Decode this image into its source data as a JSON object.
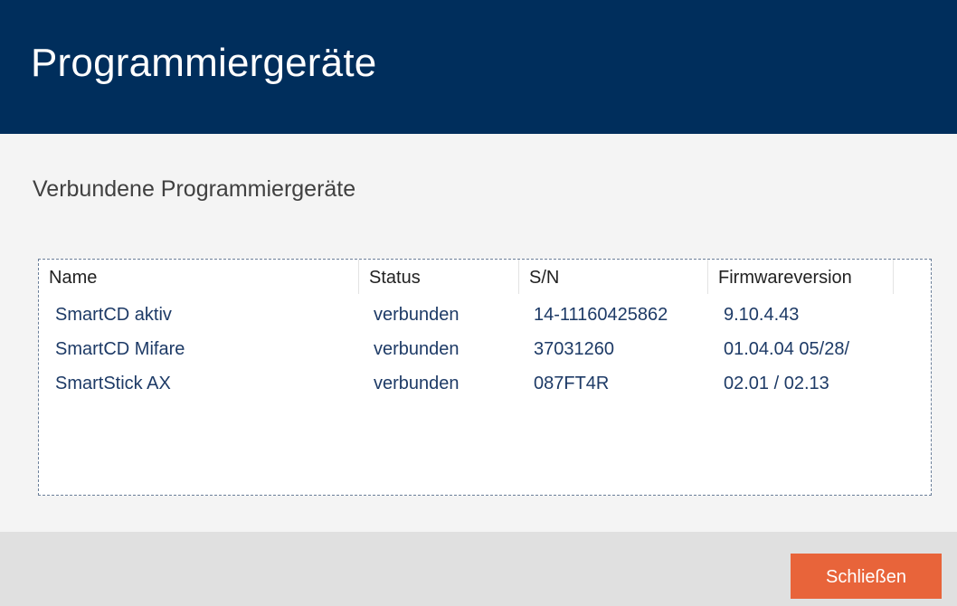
{
  "window": {
    "title": "Programmiergeräte"
  },
  "section": {
    "title": "Verbundene Programmiergeräte"
  },
  "table": {
    "columns": [
      "Name",
      "Status",
      "S/N",
      "Firmwareversion"
    ],
    "rows": [
      [
        "SmartCD aktiv",
        "verbunden",
        "14-11160425862",
        "9.10.4.43"
      ],
      [
        "SmartCD Mifare",
        "verbunden",
        "37031260",
        "01.04.04 05/28/"
      ],
      [
        "SmartStick AX",
        "verbunden",
        "087FT4R",
        "02.01 / 02.13"
      ]
    ]
  },
  "footer": {
    "close_label": "Schließen"
  },
  "colors": {
    "title_bar": "#002e5c",
    "accent_button": "#e8643a",
    "row_text": "#1d3a66"
  }
}
